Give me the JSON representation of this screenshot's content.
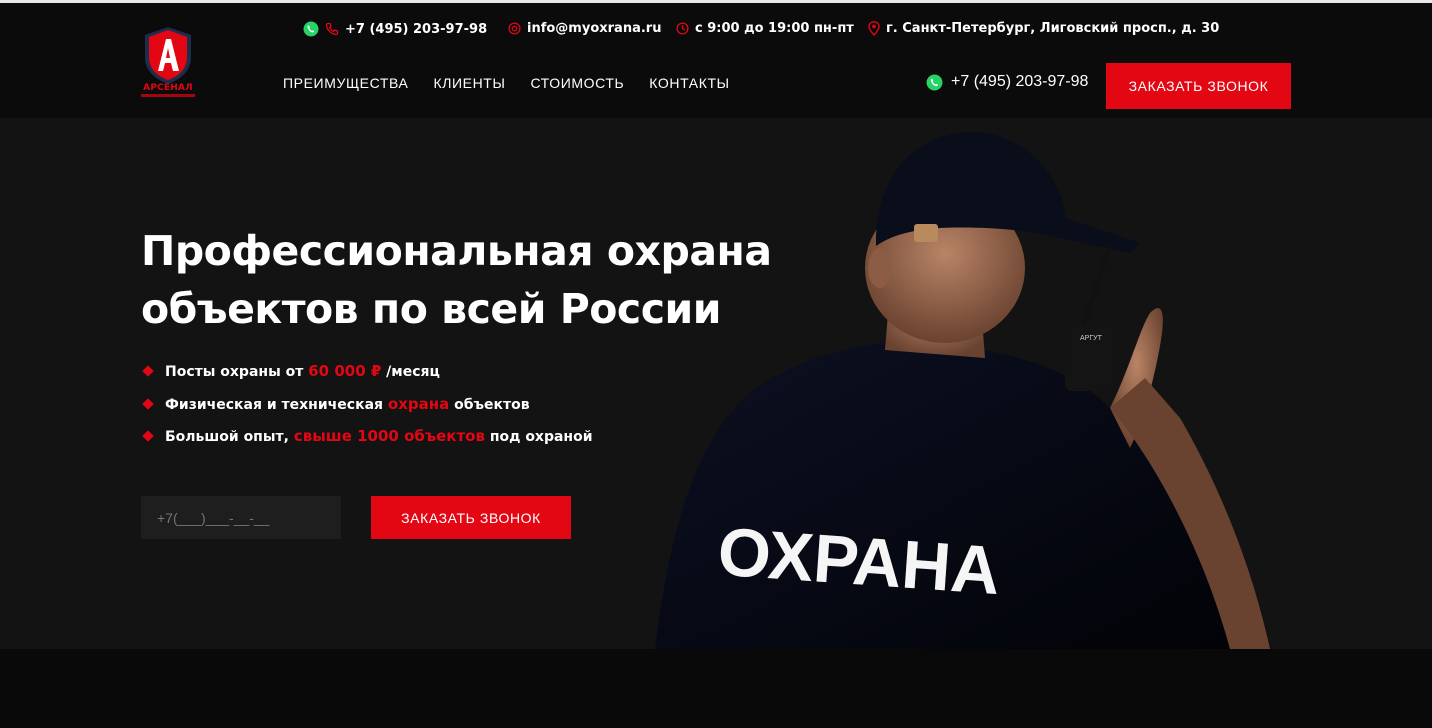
{
  "brand": {
    "name": "АРСЕНАЛ",
    "logo_letter": "A"
  },
  "topbar": {
    "phone": "+7 (495) 203-97-98",
    "email": "info@myoxrana.ru",
    "hours": "с 9:00 до 19:00 пн-пт",
    "address": "г. Санкт-Петербург, Лиговский просп., д. 30"
  },
  "nav": {
    "items": [
      "ПРЕИМУЩЕСТВА",
      "КЛИЕНТЫ",
      "СТОИМОСТЬ",
      "КОНТАКТЫ"
    ]
  },
  "header": {
    "phone": "+7 (495) 203-97-98",
    "cta_label": "ЗАКАЗАТЬ ЗВОНОК"
  },
  "hero": {
    "title_line1": "Профессиональная охрана",
    "title_line2": "объектов по всей России",
    "bullets": [
      {
        "before": "Посты охраны от ",
        "highlight": "60 000 ₽",
        "after": " /месяц"
      },
      {
        "before": "Физическая и техническая ",
        "highlight": "охрана",
        "after": " объектов"
      },
      {
        "before": "Большой опыт, ",
        "highlight": "свыше 1000 объектов",
        "after": " под охраной"
      }
    ],
    "phone_placeholder": "+7(___)___-__-__",
    "cta_label": "ЗАКАЗАТЬ ЗВОНОК",
    "shirt_text": "ОХРАНА",
    "radio_brand": "АРГУТ"
  },
  "icons": {
    "whatsapp": "whatsapp-icon",
    "phone": "phone-icon",
    "email": "at-icon",
    "hours": "clock-icon",
    "address": "map-pin-icon"
  },
  "colors": {
    "accent": "#e30613",
    "background": "#131313",
    "header_bg": "#0b0b0b",
    "whatsapp": "#25d366"
  }
}
